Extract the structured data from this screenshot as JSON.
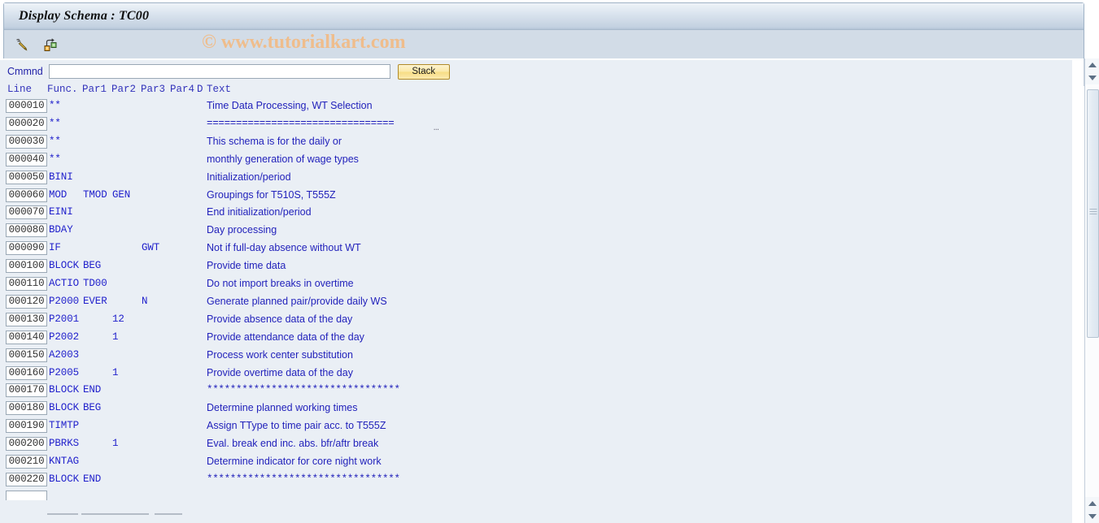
{
  "window": {
    "title": "Display Schema : TC00"
  },
  "toolbar": {
    "buttons": [
      {
        "name": "edit-schema-icon",
        "tooltip": "Display <-> Change"
      },
      {
        "name": "schema-hierarchy-icon",
        "tooltip": "Schema Structure"
      }
    ]
  },
  "watermark": {
    "text": "© www.tutorialkart.com"
  },
  "command": {
    "label": "Cmmnd",
    "value": "",
    "placeholder": "",
    "stack_label": "Stack"
  },
  "table": {
    "headers": {
      "line": "Line",
      "func": "Func.",
      "par1": "Par1",
      "par2": "Par2",
      "par3": "Par3",
      "par4": "Par4",
      "d": "D",
      "text": "Text"
    },
    "rows": [
      {
        "line": "000010",
        "func": "**",
        "par1": "",
        "par2": "",
        "par3": "",
        "par4": "",
        "d": "",
        "text": "Time Data Processing, WT Selection",
        "mono": false,
        "ellipsis": false
      },
      {
        "line": "000020",
        "func": "**",
        "par1": "",
        "par2": "",
        "par3": "",
        "par4": "",
        "d": "",
        "text": "================================",
        "mono": true,
        "ellipsis": true
      },
      {
        "line": "000030",
        "func": "**",
        "par1": "",
        "par2": "",
        "par3": "",
        "par4": "",
        "d": "",
        "text": "This schema is for the daily or",
        "mono": false,
        "ellipsis": false
      },
      {
        "line": "000040",
        "func": "**",
        "par1": "",
        "par2": "",
        "par3": "",
        "par4": "",
        "d": "",
        "text": "monthly generation of wage types",
        "mono": false,
        "ellipsis": false
      },
      {
        "line": "000050",
        "func": "BINI",
        "par1": "",
        "par2": "",
        "par3": "",
        "par4": "",
        "d": "",
        "text": "Initialization/period",
        "mono": false,
        "ellipsis": false
      },
      {
        "line": "000060",
        "func": "MOD",
        "par1": "TMOD",
        "par2": "GEN",
        "par3": "",
        "par4": "",
        "d": "",
        "text": "Groupings for T510S, T555Z",
        "mono": false,
        "ellipsis": false
      },
      {
        "line": "000070",
        "func": "EINI",
        "par1": "",
        "par2": "",
        "par3": "",
        "par4": "",
        "d": "",
        "text": "End initialization/period",
        "mono": false,
        "ellipsis": false
      },
      {
        "line": "000080",
        "func": "BDAY",
        "par1": "",
        "par2": "",
        "par3": "",
        "par4": "",
        "d": "",
        "text": "Day processing",
        "mono": false,
        "ellipsis": false
      },
      {
        "line": "000090",
        "func": "IF",
        "par1": "",
        "par2": "",
        "par3": "GWT",
        "par4": "",
        "d": "",
        "text": "Not if full-day absence without WT",
        "mono": false,
        "ellipsis": false
      },
      {
        "line": "000100",
        "func": "BLOCK",
        "par1": "BEG",
        "par2": "",
        "par3": "",
        "par4": "",
        "d": "",
        "text": "Provide time data",
        "mono": false,
        "ellipsis": false
      },
      {
        "line": "000110",
        "func": "ACTIO",
        "par1": "TD00",
        "par2": "",
        "par3": "",
        "par4": "",
        "d": "",
        "text": "Do not import breaks in overtime",
        "mono": false,
        "ellipsis": false
      },
      {
        "line": "000120",
        "func": "P2000",
        "par1": "EVER",
        "par2": "",
        "par3": "N",
        "par4": "",
        "d": "",
        "text": "Generate planned pair/provide daily WS",
        "mono": false,
        "ellipsis": false
      },
      {
        "line": "000130",
        "func": "P2001",
        "par1": "",
        "par2": "12",
        "par3": "",
        "par4": "",
        "d": "",
        "text": "Provide absence data of the day",
        "mono": false,
        "ellipsis": false
      },
      {
        "line": "000140",
        "func": "P2002",
        "par1": "",
        "par2": "1",
        "par3": "",
        "par4": "",
        "d": "",
        "text": "Provide attendance data of the day",
        "mono": false,
        "ellipsis": false
      },
      {
        "line": "000150",
        "func": "A2003",
        "par1": "",
        "par2": "",
        "par3": "",
        "par4": "",
        "d": "",
        "text": "Process work center substitution",
        "mono": false,
        "ellipsis": false
      },
      {
        "line": "000160",
        "func": "P2005",
        "par1": "",
        "par2": "1",
        "par3": "",
        "par4": "",
        "d": "",
        "text": "Provide overtime data of the day",
        "mono": false,
        "ellipsis": false
      },
      {
        "line": "000170",
        "func": "BLOCK",
        "par1": "END",
        "par2": "",
        "par3": "",
        "par4": "",
        "d": "",
        "text": "*********************************",
        "mono": true,
        "ellipsis": false
      },
      {
        "line": "000180",
        "func": "BLOCK",
        "par1": "BEG",
        "par2": "",
        "par3": "",
        "par4": "",
        "d": "",
        "text": "Determine planned working times",
        "mono": false,
        "ellipsis": false
      },
      {
        "line": "000190",
        "func": "TIMTP",
        "par1": "",
        "par2": "",
        "par3": "",
        "par4": "",
        "d": "",
        "text": "Assign TType to time pair acc. to T555Z",
        "mono": false,
        "ellipsis": false
      },
      {
        "line": "000200",
        "func": "PBRKS",
        "par1": "",
        "par2": "1",
        "par3": "",
        "par4": "",
        "d": "",
        "text": "Eval. break end inc. abs. bfr/aftr break",
        "mono": false,
        "ellipsis": false
      },
      {
        "line": "000210",
        "func": "KNTAG",
        "par1": "",
        "par2": "",
        "par3": "",
        "par4": "",
        "d": "",
        "text": "Determine indicator for core night work",
        "mono": false,
        "ellipsis": false
      },
      {
        "line": "000220",
        "func": "BLOCK",
        "par1": "END",
        "par2": "",
        "par3": "",
        "par4": "",
        "d": "",
        "text": "*********************************",
        "mono": true,
        "ellipsis": false
      }
    ]
  },
  "colors": {
    "field_text": "#2222cc",
    "label_text": "#2222a8",
    "watermark": "#efbd8c",
    "panel_bg": "#eaeff5",
    "titlebar_bg": "#c3d1e0",
    "stack_button": "#f7dc84"
  }
}
